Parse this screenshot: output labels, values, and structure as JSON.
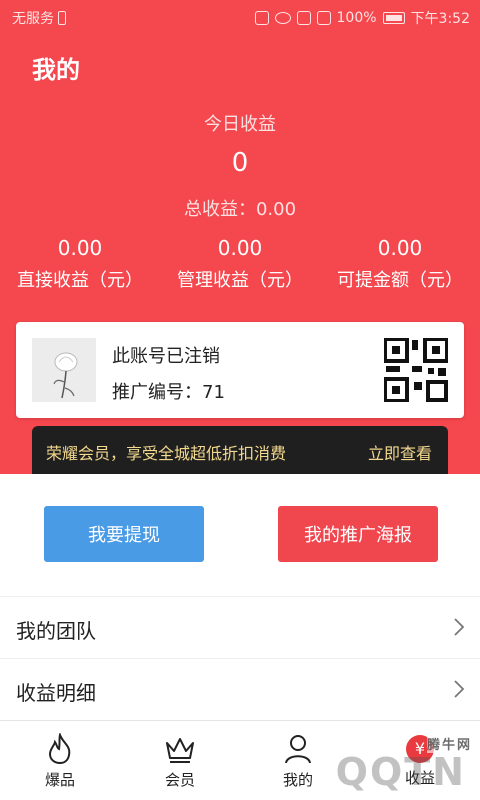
{
  "status_bar": {
    "carrier": "无服务",
    "battery": "100%",
    "time": "下午3:52"
  },
  "page": {
    "title": "我的"
  },
  "earnings": {
    "today_label": "今日收益",
    "today_value": "0",
    "total_label": "总收益：",
    "total_value": "0.00",
    "stats": [
      {
        "value": "0.00",
        "label": "直接收益（元）"
      },
      {
        "value": "0.00",
        "label": "管理收益（元）"
      },
      {
        "value": "0.00",
        "label": "可提金额（元）"
      }
    ]
  },
  "account_card": {
    "name": "此账号已注销",
    "code_label": "推广编号：",
    "code_value": "71"
  },
  "vip_banner": {
    "text": "荣耀会员，享受全城超低折扣消费",
    "link": "立即查看",
    "text_color": "#f3d98e"
  },
  "actions": {
    "withdraw": "我要提现",
    "poster": "我的推广海报"
  },
  "menu": [
    {
      "label": "我的团队"
    },
    {
      "label": "收益明细"
    }
  ],
  "tabbar": [
    {
      "label": "爆品",
      "icon": "flame-icon"
    },
    {
      "label": "会员",
      "icon": "crown-icon"
    },
    {
      "label": "我的",
      "icon": "user-icon"
    },
    {
      "label": "收益",
      "icon": "yen-icon",
      "glyph": "¥"
    }
  ],
  "watermark": {
    "small": "腾牛网",
    "big": "QQTN"
  },
  "colors": {
    "header": "#f5474e",
    "withdraw_button": "#4a9be6",
    "poster_button": "#f0474f"
  }
}
